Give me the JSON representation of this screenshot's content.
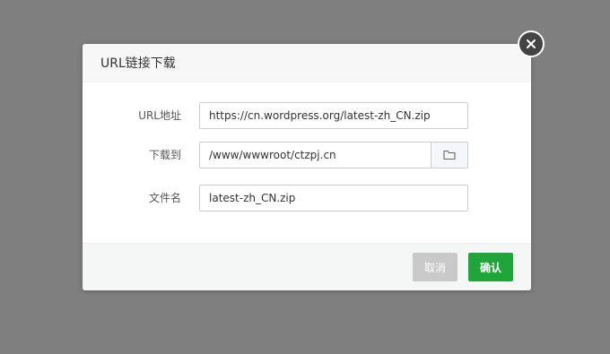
{
  "dialog": {
    "title": "URL链接下载",
    "fields": {
      "url": {
        "label": "URL地址",
        "value": "https://cn.wordpress.org/latest-zh_CN.zip"
      },
      "dest": {
        "label": "下载到",
        "value": "/www/wwwroot/ctzpj.cn",
        "button_icon": "folder-icon"
      },
      "filename": {
        "label": "文件名",
        "value": "latest-zh_CN.zip"
      }
    },
    "buttons": {
      "cancel": "取消",
      "confirm": "确认"
    },
    "close_icon": "close-icon"
  },
  "colors": {
    "overlay": "#7f7f7f",
    "confirm": "#20a53a",
    "cancel": "#c9c9c9"
  }
}
